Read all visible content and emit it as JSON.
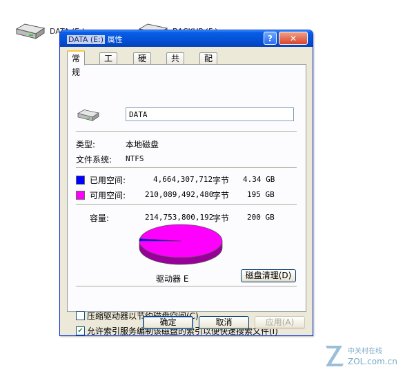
{
  "desktop": {
    "drive1_label": "DATA (E:)",
    "drive2_label": "BACKUP (F:)"
  },
  "dialog": {
    "title_volume": "DATA (E:)",
    "title_suffix": "属性",
    "help": "?",
    "close": "✕",
    "tabs": [
      "常规",
      "工具",
      "硬件",
      "共享",
      "配额"
    ],
    "general": {
      "name_value": "DATA",
      "type_label": "类型:",
      "type_value": "本地磁盘",
      "fs_label": "文件系统:",
      "fs_value": "NTFS",
      "used_label": "已用空间:",
      "used_bytes": "4,664,307,712",
      "used_unit": "字节",
      "used_size": "4.34 GB",
      "free_label": "可用空间:",
      "free_bytes": "210,089,492,480",
      "free_unit": "字节",
      "free_size": "195 GB",
      "capacity_label": "容量:",
      "capacity_bytes": "214,753,800,192",
      "capacity_unit": "字节",
      "capacity_size": "200 GB",
      "used_fraction": 0.0217,
      "drive_caption": "驱动器 E",
      "cleanup_button": "磁盘清理(D)",
      "compress_label": "压缩驱动器以节约磁盘空间(C)",
      "compress_checked": false,
      "index_label": "允许索引服务编制该磁盘的索引以便快速搜索文件(I)",
      "index_checked": true
    },
    "buttons": {
      "ok": "确定",
      "cancel": "取消",
      "apply": "应用(A)"
    }
  },
  "colors": {
    "used": "#0000ff",
    "free": "#ff00ff",
    "titlebar": "#0454d8"
  },
  "watermark": {
    "brand": "中关村在线",
    "site": "ZOL.com.cn"
  }
}
